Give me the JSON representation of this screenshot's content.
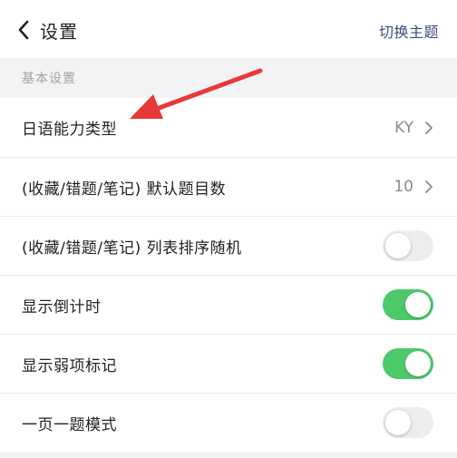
{
  "header": {
    "title": "设置",
    "theme_button": "切换主题"
  },
  "section": {
    "title": "基本设置"
  },
  "rows": [
    {
      "label": "日语能力类型",
      "value": "KY",
      "type": "link"
    },
    {
      "label": "(收藏/错题/笔记) 默认题目数",
      "value": "10",
      "type": "link"
    },
    {
      "label": "(收藏/错题/笔记) 列表排序随机",
      "on": false,
      "type": "toggle"
    },
    {
      "label": "显示倒计时",
      "on": true,
      "type": "toggle"
    },
    {
      "label": "显示弱项标记",
      "on": true,
      "type": "toggle"
    },
    {
      "label": "一页一题模式",
      "on": false,
      "type": "toggle"
    }
  ],
  "colors": {
    "accent_text": "#3f4a78",
    "toggle_on": "#4cca6b",
    "toggle_off": "#ededf0",
    "annotation_arrow": "#e8383a"
  },
  "icons": {
    "back": "chevron-left-icon",
    "row_link": "chevron-right-icon",
    "annotation": "red-arrow-annotation"
  }
}
